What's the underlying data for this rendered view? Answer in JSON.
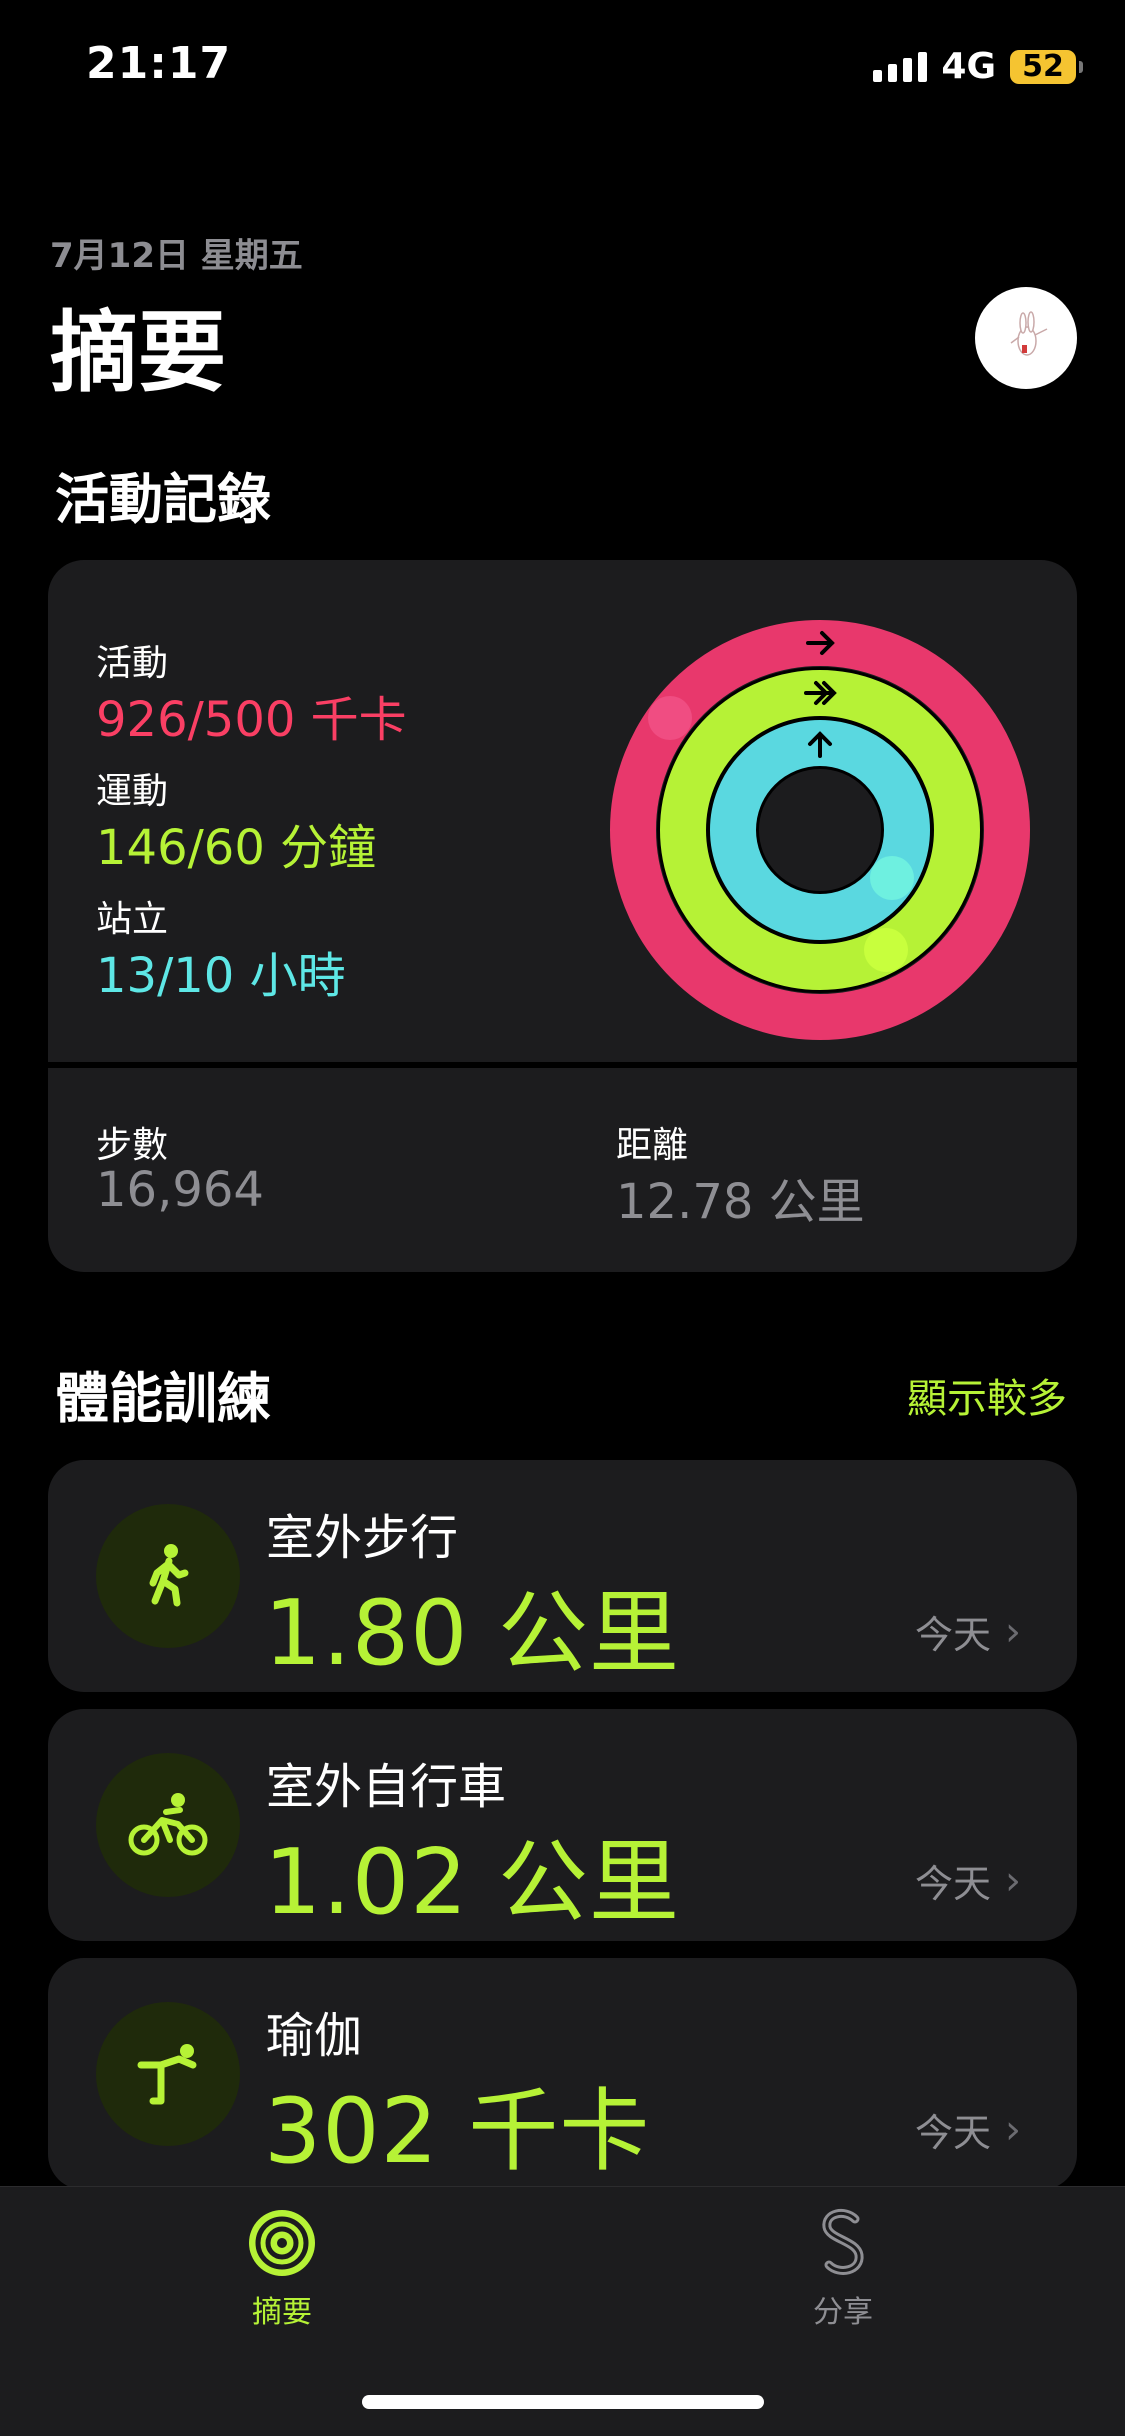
{
  "status_bar": {
    "time": "21:17",
    "network": "4G",
    "battery": "52"
  },
  "header": {
    "date": "7月12日 星期五",
    "title": "摘要"
  },
  "activity": {
    "section_title": "活動記錄",
    "move": {
      "label": "活動",
      "value": "926/500 千卡",
      "color": "#fa3f64",
      "progress": 1.85
    },
    "exercise": {
      "label": "運動",
      "value": "146/60 分鐘",
      "color": "#b6f236",
      "progress": 2.43
    },
    "stand": {
      "label": "站立",
      "value": "13/10 小時",
      "color": "#5ee7e6",
      "progress": 1.3
    },
    "steps": {
      "label": "步數",
      "value": "16,964"
    },
    "distance": {
      "label": "距離",
      "value": "12.78 公里"
    }
  },
  "workouts": {
    "section_title": "體能訓練",
    "show_more": "顯示較多",
    "items": [
      {
        "name": "室外步行",
        "value": "1.80 公里",
        "date": "今天",
        "icon": "walking-icon"
      },
      {
        "name": "室外自行車",
        "value": "1.02 公里",
        "date": "今天",
        "icon": "cycling-icon"
      },
      {
        "name": "瑜伽",
        "value": "302 千卡",
        "date": "今天",
        "icon": "yoga-icon"
      }
    ]
  },
  "tab_bar": {
    "tabs": [
      {
        "label": "摘要",
        "icon": "rings-icon",
        "active": true
      },
      {
        "label": "分享",
        "icon": "sharing-icon",
        "active": false
      }
    ]
  },
  "colors": {
    "accent": "#b6f236",
    "move": "#fa3f64",
    "stand": "#5ee7e6"
  }
}
